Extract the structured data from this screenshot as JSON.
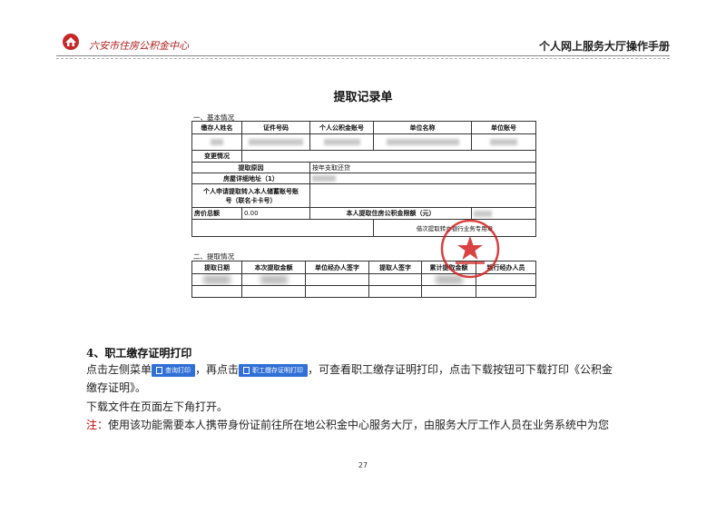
{
  "header": {
    "org_name": "六安市住房公积金中心",
    "manual_title": "个人网上服务大厅操作手册"
  },
  "form": {
    "title": "提取记录单",
    "section1": "一、基本情况",
    "cols": [
      "缴存人姓名",
      "证件号码",
      "个人公积金账号",
      "单位名称",
      "单位账号"
    ],
    "change_label": "变更情况",
    "reason_label": "提取原因",
    "reason_value": "按年支取还贷",
    "address_label": "房屋详细地址（1）",
    "account_label_1": "个人申请提取转入本人储蓄账号账",
    "account_label_2": "号（联名卡卡号）",
    "price_label": "房价总额",
    "price_value": "0.00",
    "limit_label": "本人提取住房公积金限额（元）",
    "notice_text": "借次提取转办银行业务专用章",
    "section2": "二、提取情况",
    "cols2": [
      "提取日期",
      "本次提取金额",
      "单位经办人签字",
      "提取人签字",
      "累计提取金额",
      "银行经办人员"
    ]
  },
  "body": {
    "heading": "4、职工缴存证明打印",
    "line1_a": "点击左侧菜单",
    "btn1": "查询打印",
    "line1_b": "，再点击",
    "btn2": "职工缴存证明打印",
    "line1_c": "，可查看职工缴存证明打印，点击下载按钮可下载打印《公积金",
    "line1_d": "缴存证明》。",
    "line2": "下载文件在页面左下角打开。",
    "note_label": "注：",
    "note_text": "使用该功能需要本人携带身份证前往所在地公积金中心服务大厅，由服务大厅工作人员在业务系统中为您"
  },
  "page_number": "27",
  "colors": {
    "accent": "#b22222",
    "button": "#2f6fd6",
    "stamp": "#d42020"
  }
}
